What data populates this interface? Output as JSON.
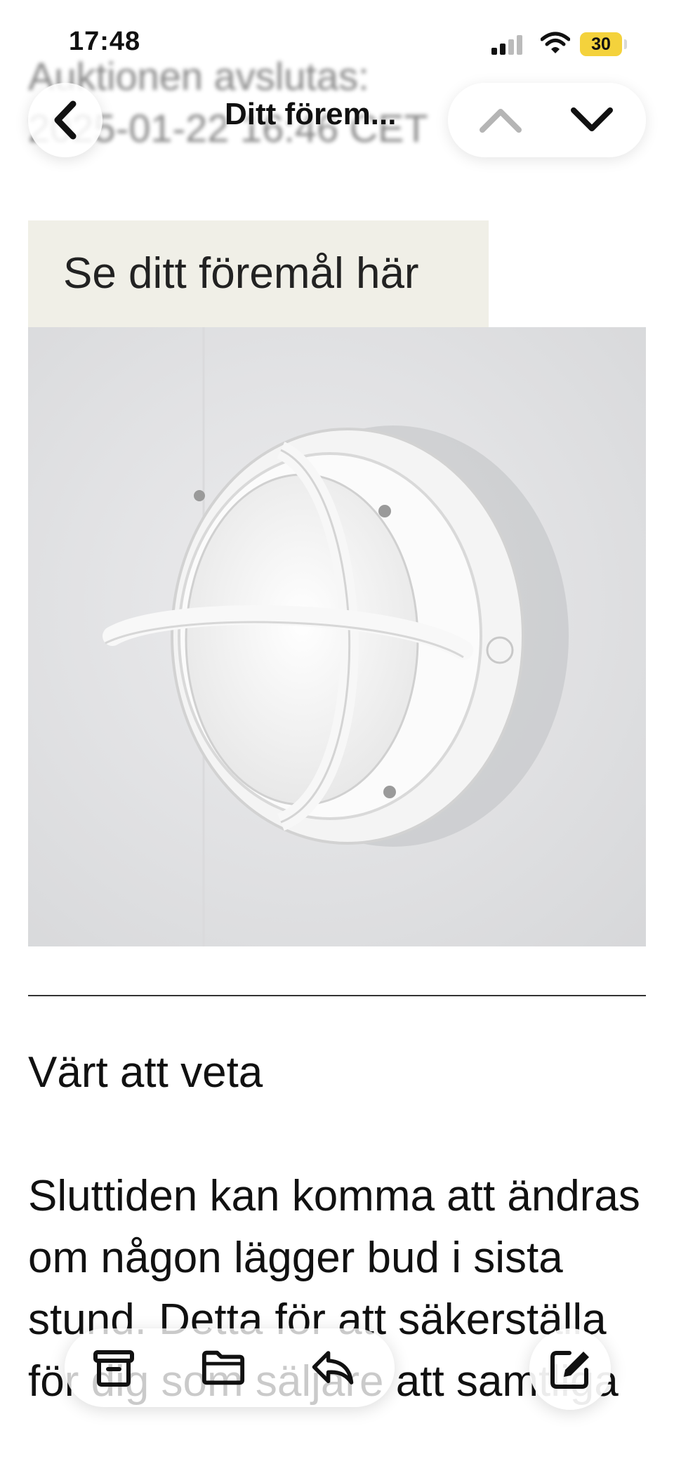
{
  "status_bar": {
    "time": "17:48",
    "battery": "30"
  },
  "scrolled_behind": {
    "text": "Auktionen avslutas:\n2025-01-22 16:46 CET"
  },
  "nav": {
    "title": "Ditt förem..."
  },
  "email": {
    "view_item_label": "Se ditt föremål här",
    "section_heading": "Värt att veta",
    "body": "Sluttiden kan komma att ändras om någon lägger bud i sista stund. Detta för att säkerställa för dig som säljare att samtliga"
  },
  "icons": {
    "back": "chevron-left-icon",
    "prev": "chevron-up-icon",
    "next": "chevron-down-icon",
    "archive": "archive-icon",
    "folder": "folder-icon",
    "reply": "reply-icon",
    "compose": "compose-icon"
  },
  "colors": {
    "label_bg": "#f0efe7",
    "battery": "#f4d23c"
  }
}
